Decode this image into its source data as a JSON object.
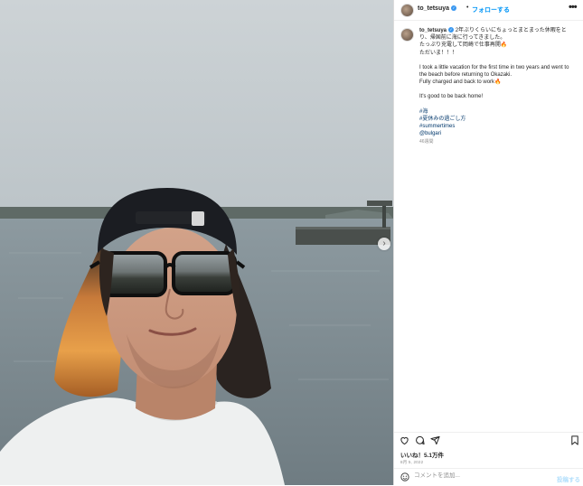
{
  "post": {
    "username": "to_tetsuya",
    "verified_icon": "verified-badge-icon",
    "dot": "•",
    "follow_label": "フォローする",
    "more_icon": "more-options-icon",
    "caption": {
      "username": "to_tetsuya",
      "lines_jp": [
        "2年ぶりくらいにちょっとまとまった休暇をとり、帰国前に海に行ってきました。",
        "たっぷり充電して岡崎で仕事再開🔥",
        "ただいま！！！"
      ],
      "lines_en": [
        "I took a little vacation for the first time in two years and went to the beach before returning to Okazaki.",
        "Fully charged and back to work🔥"
      ],
      "line_home": "It's good to be back home!",
      "tags": [
        "#海",
        "#夏休みの過ごし方",
        "#summertimes",
        "@bulgari"
      ],
      "time_ago": "46週間"
    },
    "likes": "いいね！5.1万件",
    "date": "8月 5, 2022",
    "comment_placeholder": "コメントを追加...",
    "post_button": "投稿する"
  },
  "colors": {
    "accent": "#0095f6",
    "link": "#00376b",
    "text": "#262626",
    "muted": "#8e8e8e"
  }
}
